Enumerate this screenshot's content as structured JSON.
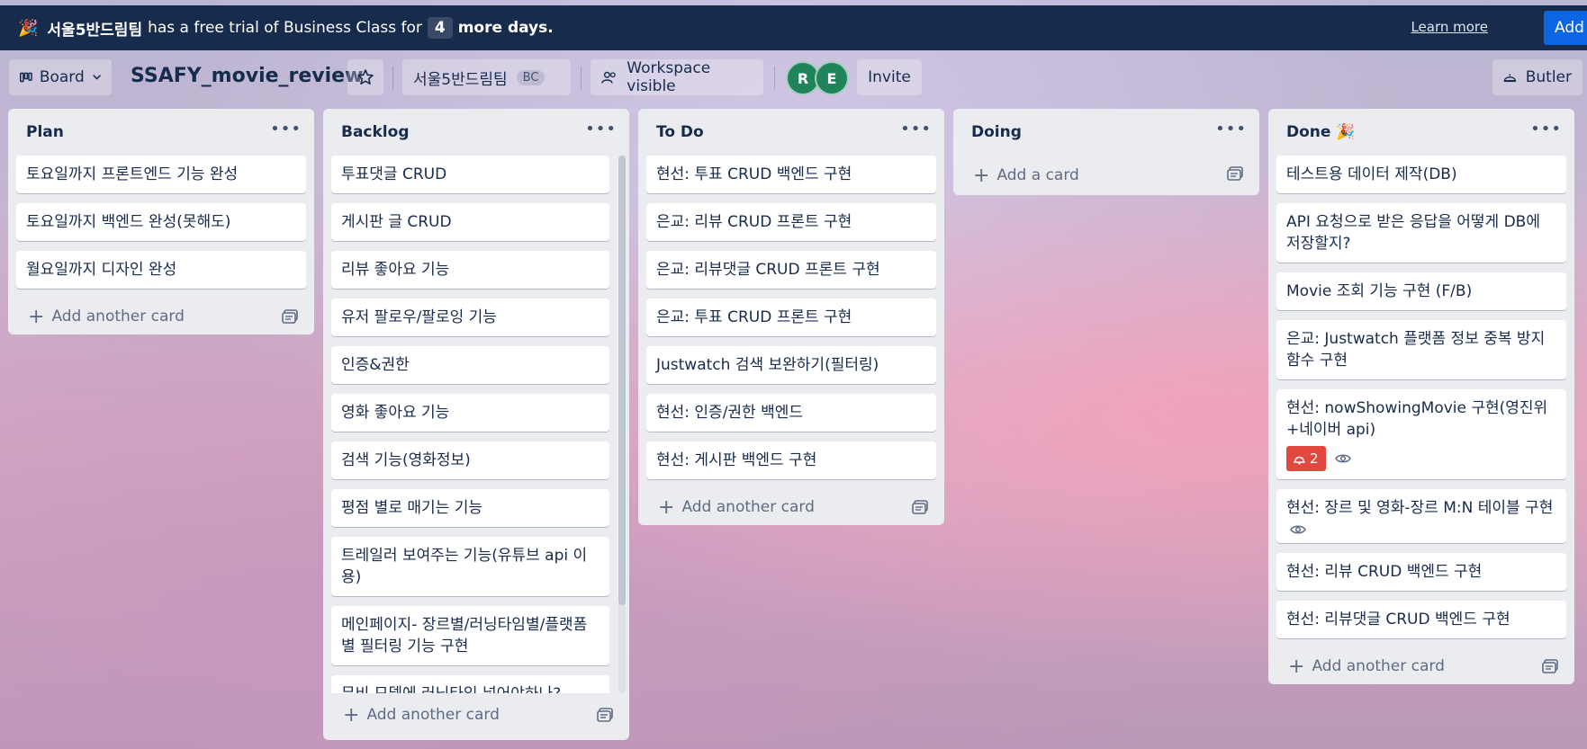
{
  "banner": {
    "icon": "party-popper-icon",
    "workspace": "서울5반드림팀",
    "text_before": "has a free trial of Business Class for",
    "days": "4",
    "text_after": "more days.",
    "learn_more": "Learn more",
    "add": "Add"
  },
  "header": {
    "view_label": "Board",
    "board_title": "SSAFY_movie_review",
    "workspace_name": "서울5반드림팀",
    "workspace_badge": "BC",
    "visibility": "Workspace visible",
    "members": [
      "R",
      "E"
    ],
    "invite": "Invite",
    "butler": "Butler"
  },
  "lists": [
    {
      "title": "Plan",
      "cards": [
        {
          "text": "토요일까지 프론트엔드 기능 완성"
        },
        {
          "text": "토요일까지 백엔드 완성(못해도)"
        },
        {
          "text": "월요일까지 디자인 완성"
        }
      ],
      "add_label": "Add another card"
    },
    {
      "title": "Backlog",
      "cards": [
        {
          "text": "투표댓글 CRUD"
        },
        {
          "text": "게시판 글 CRUD"
        },
        {
          "text": "리뷰 좋아요 기능"
        },
        {
          "text": "유저 팔로우/팔로잉 기능"
        },
        {
          "text": "인증&권한"
        },
        {
          "text": "영화 좋아요 기능"
        },
        {
          "text": "검색 기능(영화정보)"
        },
        {
          "text": "평점 별로 매기는 기능"
        },
        {
          "text": "트레일러 보여주는 기능(유튜브 api 이용)"
        },
        {
          "text": "메인페이지- 장르별/러닝타임별/플랫폼별 필터링 기능 구현"
        },
        {
          "text": "무비 모델에 러닝타임 넣어야하나?"
        }
      ],
      "add_label": "Add another card"
    },
    {
      "title": "To Do",
      "cards": [
        {
          "text": "현선: 투표 CRUD 백엔드 구현"
        },
        {
          "text": "은교: 리뷰 CRUD 프론트 구현"
        },
        {
          "text": "은교: 리뷰댓글 CRUD 프론트 구현"
        },
        {
          "text": "은교: 투표 CRUD 프론트 구현"
        },
        {
          "text": "Justwatch 검색 보완하기(필터링)"
        },
        {
          "text": "현선: 인증/권한 백엔드"
        },
        {
          "text": "현선: 게시판 백엔드 구현"
        }
      ],
      "add_label": "Add another card"
    },
    {
      "title": "Doing",
      "cards": [],
      "add_label": "Add a card"
    },
    {
      "title": "Done 🎉",
      "cards": [
        {
          "text": "테스트용 데이터 제작(DB)"
        },
        {
          "text": "API 요청으로 받은 응답을 어떻게 DB에 저장할지?"
        },
        {
          "text": "Movie 조회 기능 구현 (F/B)"
        },
        {
          "text": "은교: Justwatch 플랫폼 정보 중복 방지 함수 구현"
        },
        {
          "text": "현선: nowShowingMovie 구현(영진위+네이버 api)",
          "notifications": "2",
          "watching": true
        },
        {
          "text": "현선: 장르 및 영화-장르 M:N 테이블 구현",
          "watching": true
        },
        {
          "text": "현선: 리뷰 CRUD 백엔드 구현"
        },
        {
          "text": "현선: 리뷰댓글 CRUD 백엔드 구현"
        }
      ],
      "add_label": "Add another card"
    }
  ],
  "colors": {
    "banner_bg": "#172b4d",
    "list_bg": "#ebecf0",
    "notification_red": "#e2483d",
    "avatar_green": "#1f845a",
    "add_blue": "#0c66e4"
  }
}
